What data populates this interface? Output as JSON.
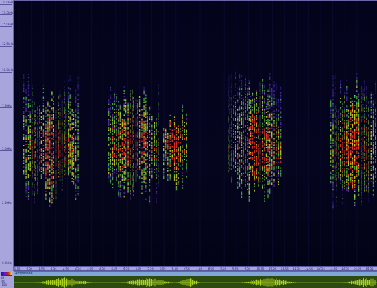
{
  "freq_ruler": {
    "ticks": [
      "20.0kHz",
      "17.5kHz",
      "15.0kHz",
      "12.5kHz",
      "10.0kHz",
      "7.5kHz",
      "5.0kHz",
      "2.5kHz",
      "0.0kHz"
    ]
  },
  "time_axis": {
    "ticks": [
      "0.0s",
      "0.5s",
      "1.0s",
      "1.5s",
      "2.0s",
      "2.5s",
      "3.0s",
      "3.5s",
      "4.0s",
      "4.5s",
      "5.0s",
      "5.5s",
      "6.0s",
      "6.5s",
      "7.0s",
      "7.5s",
      "8.0s",
      "8.5s",
      "9.0s",
      "9.5s",
      "10.0s",
      "10.5s",
      "11.0s",
      "11.5s",
      "12.0s",
      "12.5s",
      "13.0s",
      "13.5s",
      "14.0s",
      "14.5s",
      "15.0s"
    ]
  },
  "color_scale": {
    "top_label": "dB",
    "values": [
      "-60",
      "-100"
    ]
  },
  "amplitude_panel": {
    "label": "Amplitude"
  },
  "colors": {
    "background": "#040414",
    "ruler": "#a8a4dc",
    "waveform_bg": "#2d4a10",
    "waveform": "#b8e020"
  }
}
